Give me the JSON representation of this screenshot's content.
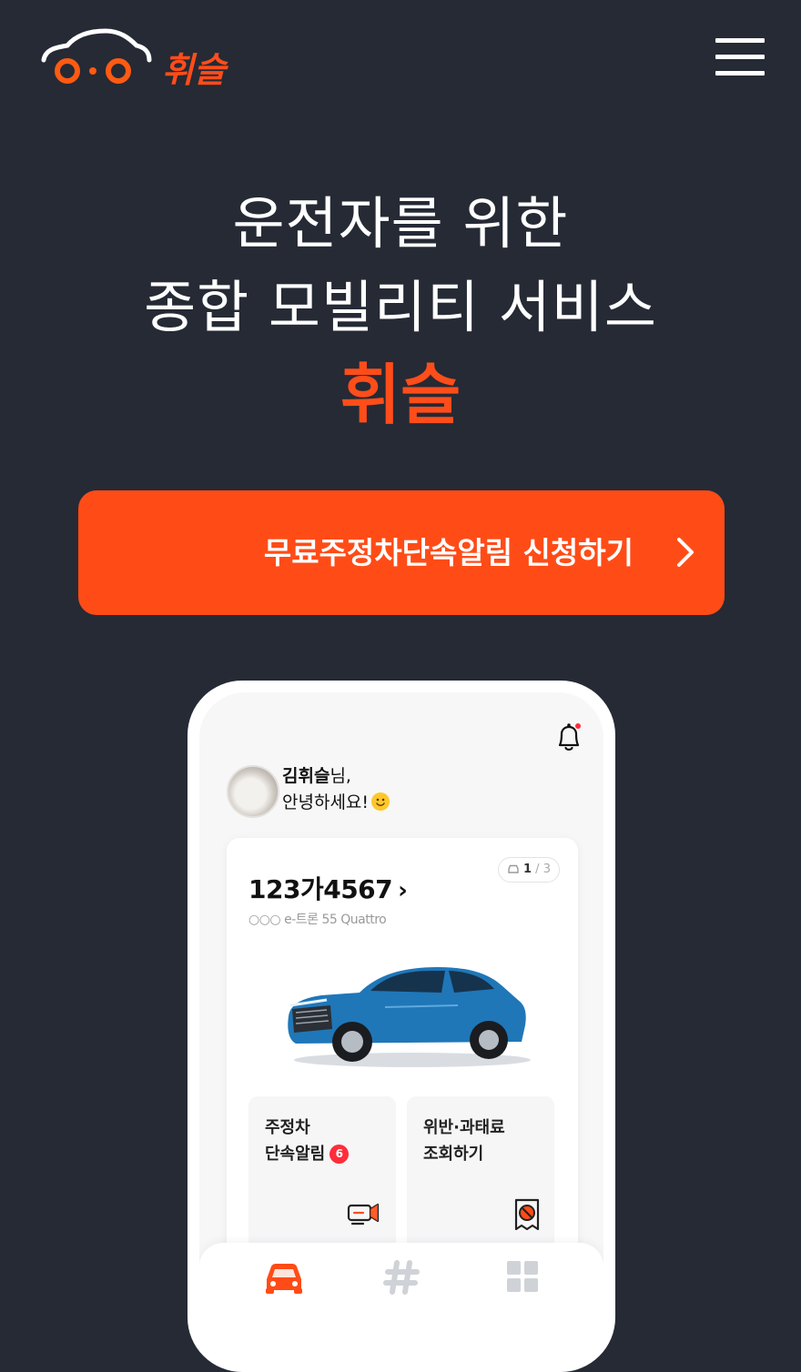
{
  "brand": {
    "name": "휘슬",
    "color": "#ff4d1a"
  },
  "header": {
    "menu_icon": "hamburger-icon"
  },
  "hero": {
    "line1": "운전자를 위한",
    "line2": "종합 모빌리티 서비스",
    "brand": "휘슬"
  },
  "cta": {
    "label": "무료주정차단속알림 신청하기",
    "icon": "chevron-right-icon"
  },
  "phone": {
    "user_name": "김휘슬",
    "honorific": "님,",
    "greeting": "안녕하세요!",
    "vehicle": {
      "plate": "123가4567",
      "arrow": "›",
      "model": "○○○ e-트론 55 Quattro",
      "counter_current": "1",
      "counter_sep": " / ",
      "counter_total": "3"
    },
    "tiles": [
      {
        "line1": "주정차",
        "line2": "단속알림",
        "badge": "6",
        "icon": "cctv-camera-icon"
      },
      {
        "line1": "위반·과태료",
        "line2": "조회하기",
        "icon": "receipt-ban-icon"
      }
    ],
    "tabs": [
      {
        "icon": "car-icon",
        "active": true
      },
      {
        "icon": "hashtag-icon",
        "active": false
      },
      {
        "icon": "grid-icon",
        "active": false
      }
    ]
  },
  "colors": {
    "background": "#252a35",
    "accent": "#ff4c17",
    "badge": "#ff2d3a"
  }
}
